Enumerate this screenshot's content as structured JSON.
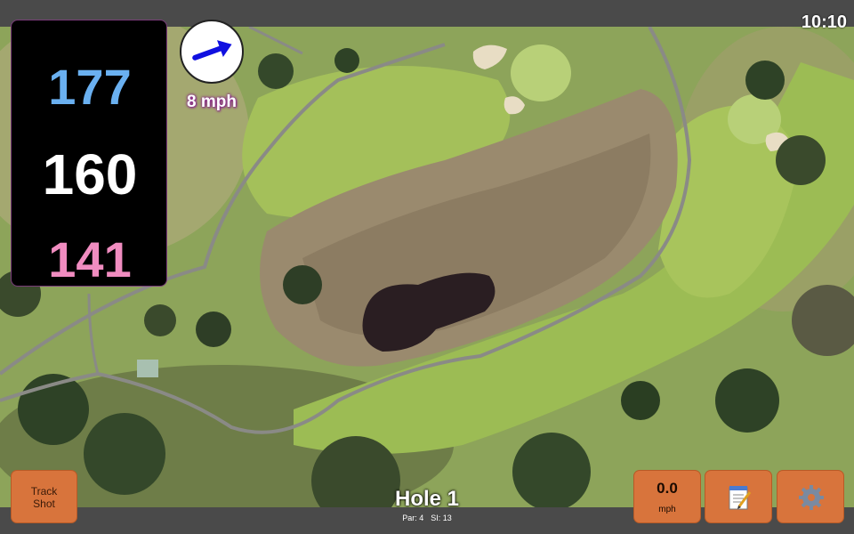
{
  "clock": "10:10",
  "distances": {
    "back": "177",
    "middle": "160",
    "front": "141"
  },
  "wind": {
    "speed": "8 mph",
    "arrow_icon": "wind-arrow-icon"
  },
  "buttons": {
    "track_shot_line1": "Track",
    "track_shot_line2": "Shot",
    "speed_value": "0.0",
    "speed_unit": "mph",
    "notes_icon": "notepad-icon",
    "settings_icon": "gear-icon"
  },
  "hole": {
    "title": "Hole 1",
    "par": "Par: 4",
    "stroke_index": "SI: 13"
  },
  "colors": {
    "back_distance": "#6ab0f0",
    "middle_distance": "#ffffff",
    "front_distance": "#f08cc0",
    "button": "#d8743c",
    "wind_arrow": "#1010e0"
  }
}
